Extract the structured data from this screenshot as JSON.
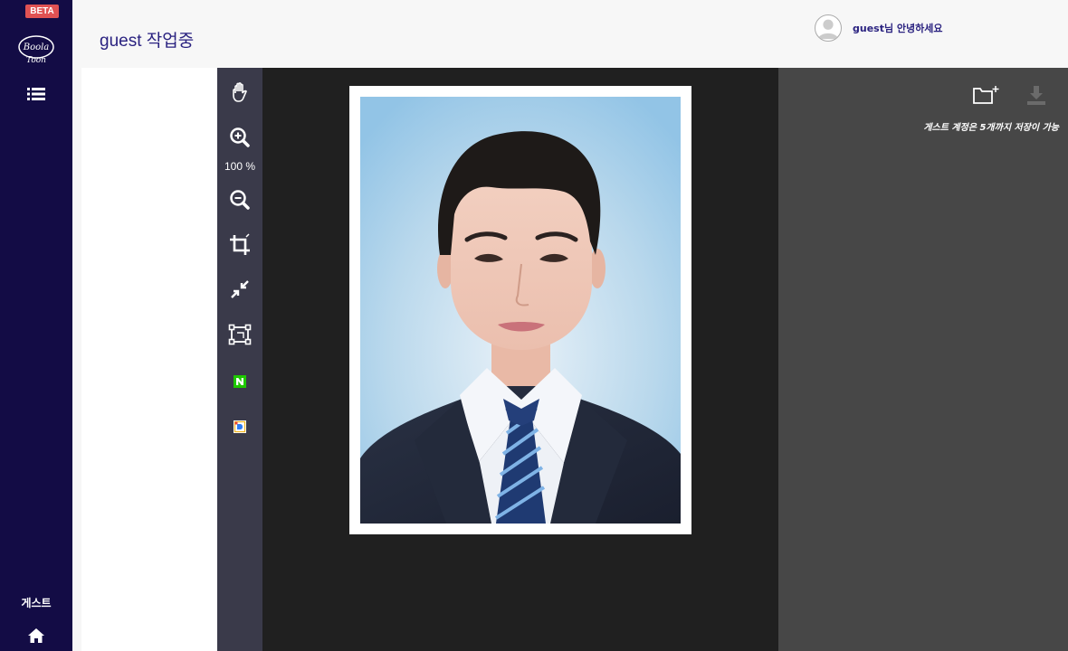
{
  "nav": {
    "beta_badge": "BETA",
    "logo_text": "Boola Toon",
    "user_label": "게스트"
  },
  "header": {
    "work_title": "guest 작업중",
    "greeting": "guest님 안녕하세요"
  },
  "toolbar": {
    "zoom_level": "100 %"
  },
  "right_panel": {
    "notice": "게스트 계정은 5개까지 저장이 가능"
  },
  "colors": {
    "nav_bg": "#130c45",
    "beta_badge": "#e05253",
    "title_text": "#2a2280",
    "toolbar_bg": "#3a3a4a",
    "canvas_bg": "#202020",
    "right_panel_bg": "#474747"
  },
  "icons": [
    "menu-list-icon",
    "home-icon",
    "hand-icon",
    "zoom-in-icon",
    "zoom-out-icon",
    "crop-icon",
    "collapse-icon",
    "transform-icon",
    "naver-icon",
    "daum-icon",
    "folder-add-icon",
    "download-icon",
    "user-avatar-icon"
  ]
}
